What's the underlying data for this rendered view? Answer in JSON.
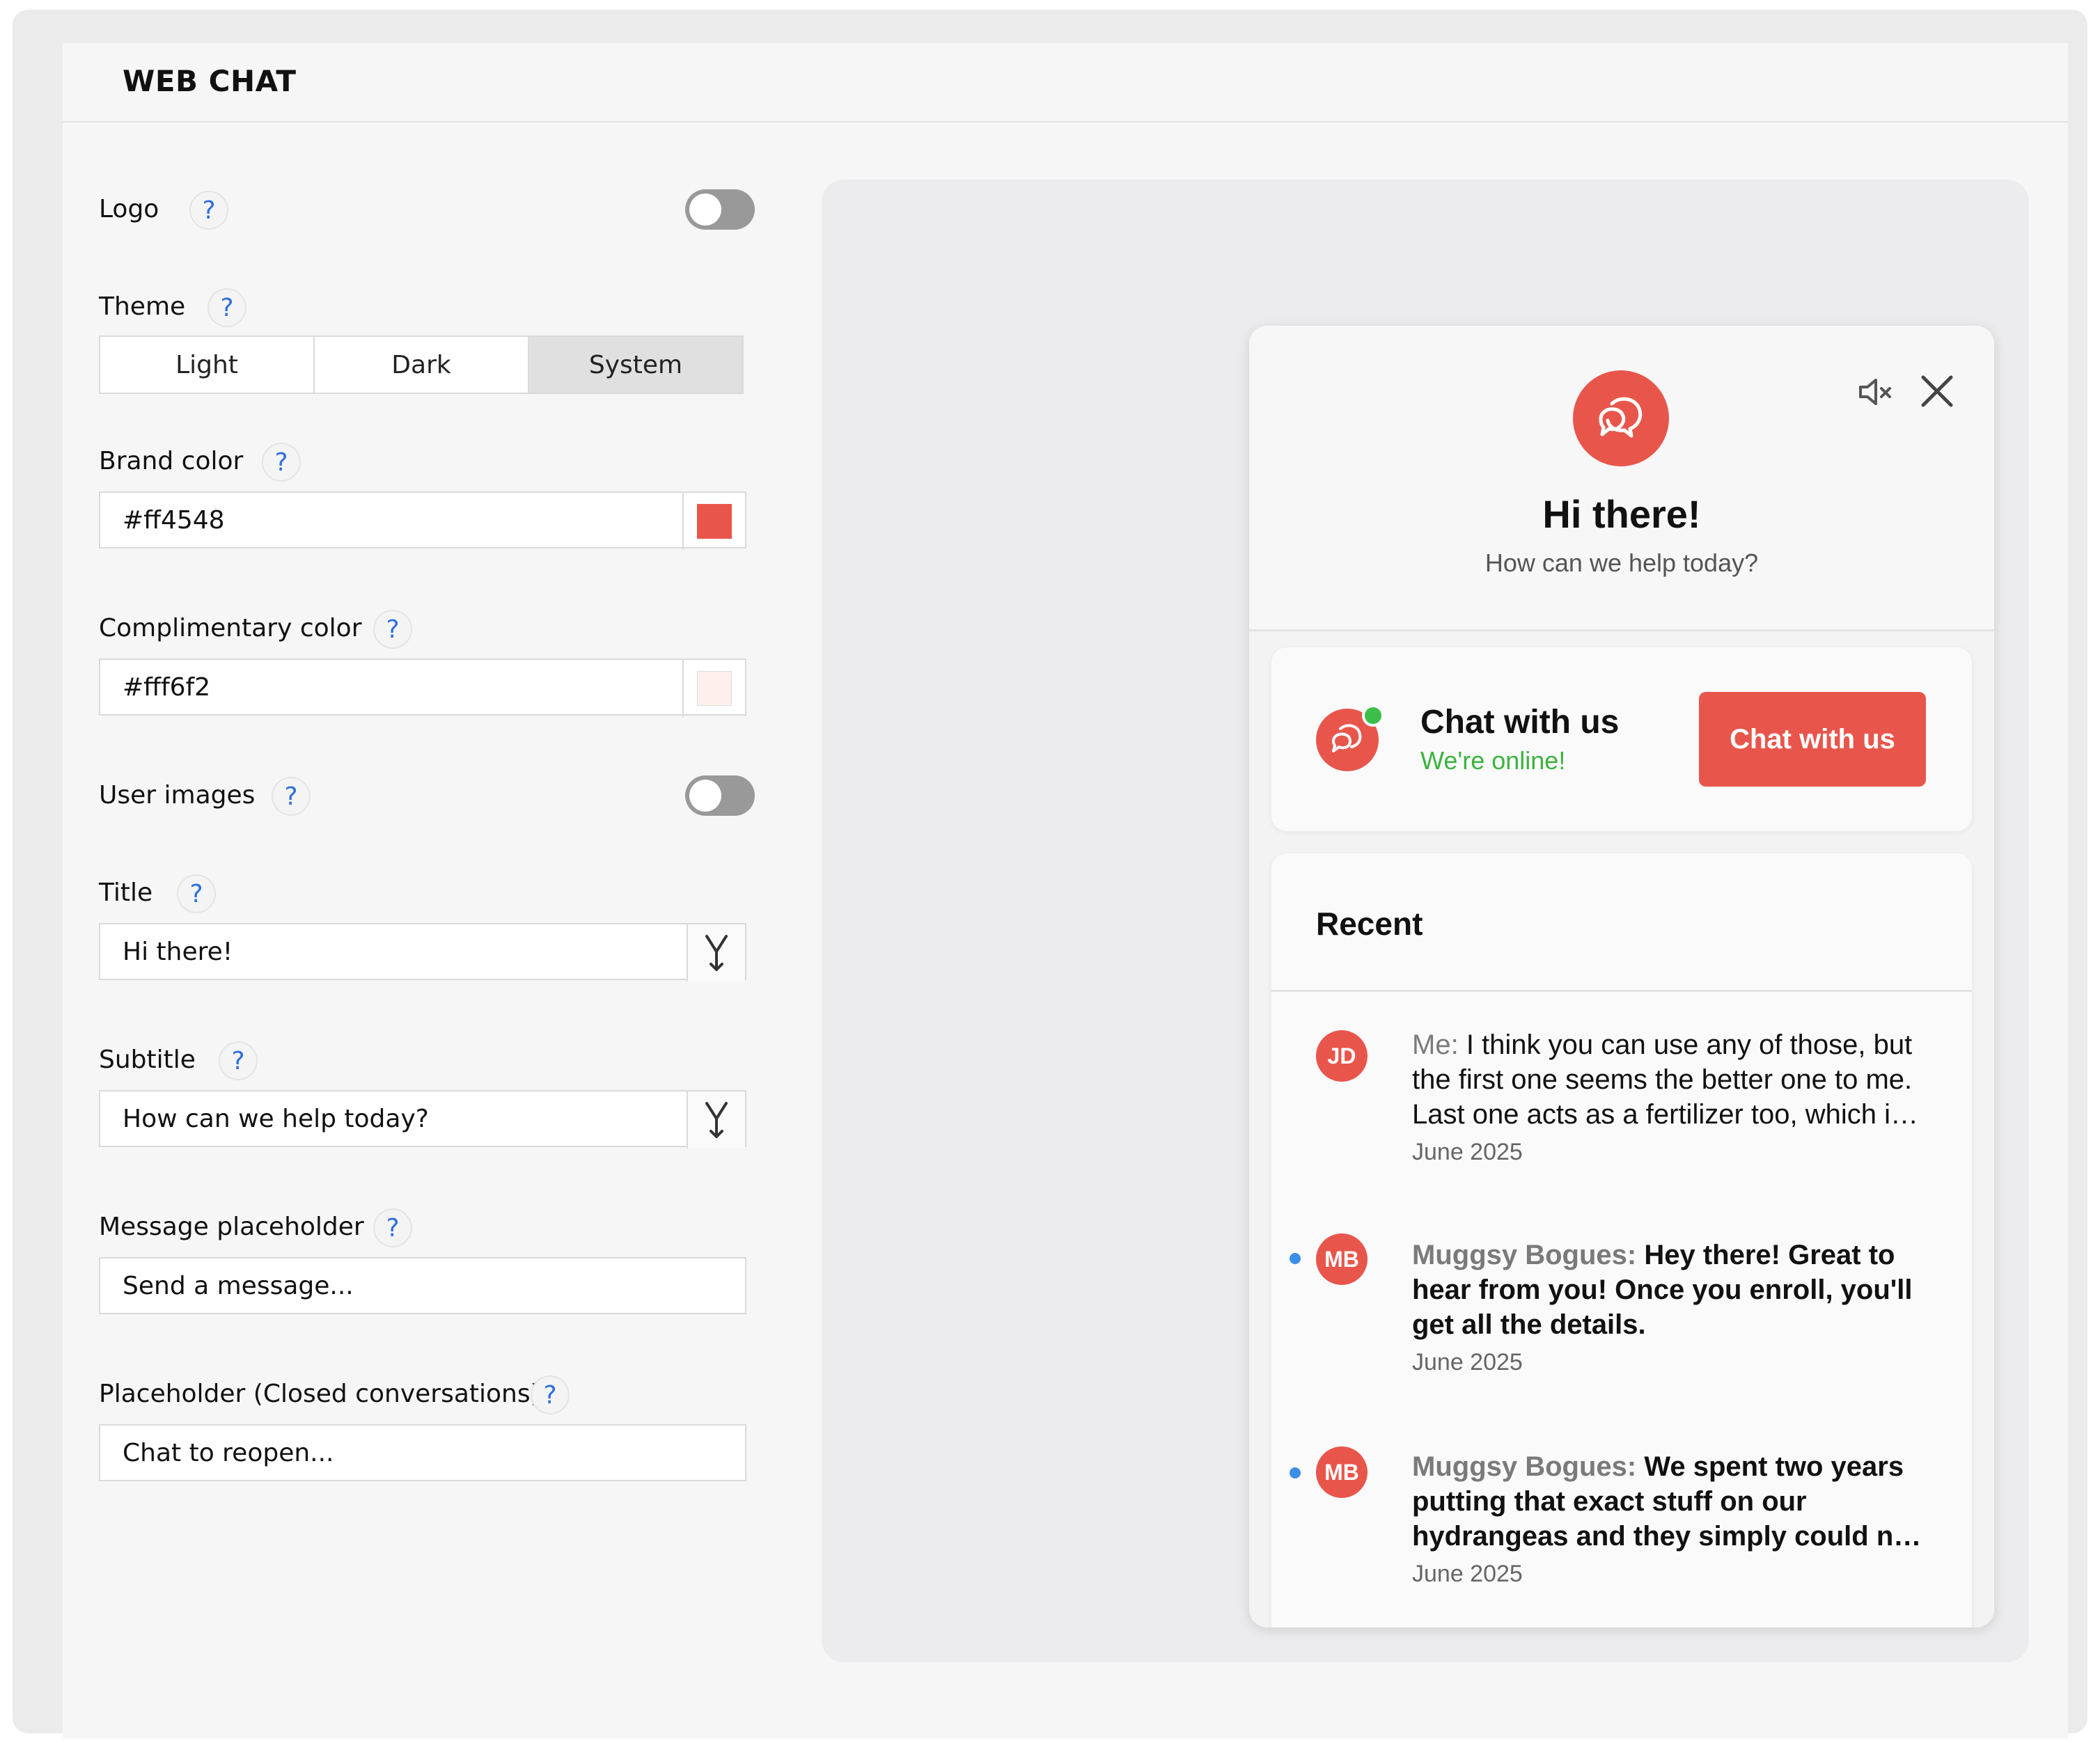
{
  "header": {
    "title": "WEB CHAT"
  },
  "form": {
    "logo": {
      "label": "Logo",
      "help": "?",
      "enabled": false
    },
    "theme": {
      "label": "Theme",
      "help": "?",
      "options": [
        "Light",
        "Dark",
        "System"
      ],
      "selected": "System"
    },
    "brand_color": {
      "label": "Brand color",
      "help": "?",
      "value": "#ff4548",
      "swatch": "#e8564b"
    },
    "complimentary_color": {
      "label": "Complimentary color",
      "help": "?",
      "value": "#fff6f2",
      "swatch": "#fdf0ec"
    },
    "user_images": {
      "label": "User images",
      "help": "?",
      "enabled": false
    },
    "title": {
      "label": "Title",
      "help": "?",
      "value": "Hi there!"
    },
    "subtitle": {
      "label": "Subtitle",
      "help": "?",
      "value": "How can we help today?"
    },
    "message_placeholder": {
      "label": "Message placeholder",
      "help": "?",
      "value": "Send a message..."
    },
    "closed_placeholder": {
      "label": "Placeholder (Closed conversations)",
      "help": "?",
      "value": "Chat to reopen..."
    }
  },
  "preview": {
    "title": "Hi there!",
    "subtitle": "How can we help today?",
    "chat_card": {
      "title": "Chat with us",
      "status": "We're online!",
      "button": "Chat with us"
    },
    "recent": {
      "title": "Recent",
      "messages": [
        {
          "initials": "JD",
          "sender": "Me:",
          "text": "I think you can use any of those, but the first one seems the better one to me. Last one acts as a fertilizer too, which i…",
          "date": "June 2025",
          "unread": false
        },
        {
          "initials": "MB",
          "sender": "Muggsy Bogues:",
          "text": "Hey there! Great to hear from you! Once you enroll, you'll get all the details.",
          "date": "June 2025",
          "unread": true
        },
        {
          "initials": "MB",
          "sender": "Muggsy Bogues:",
          "text": "We spent two years putting that exact stuff on our hydrangeas and they simply could n…",
          "date": "June 2025",
          "unread": true
        }
      ]
    }
  },
  "colors": {
    "brand": "#e8564b",
    "online": "#3bb33f",
    "unread": "#3a8ee6"
  }
}
